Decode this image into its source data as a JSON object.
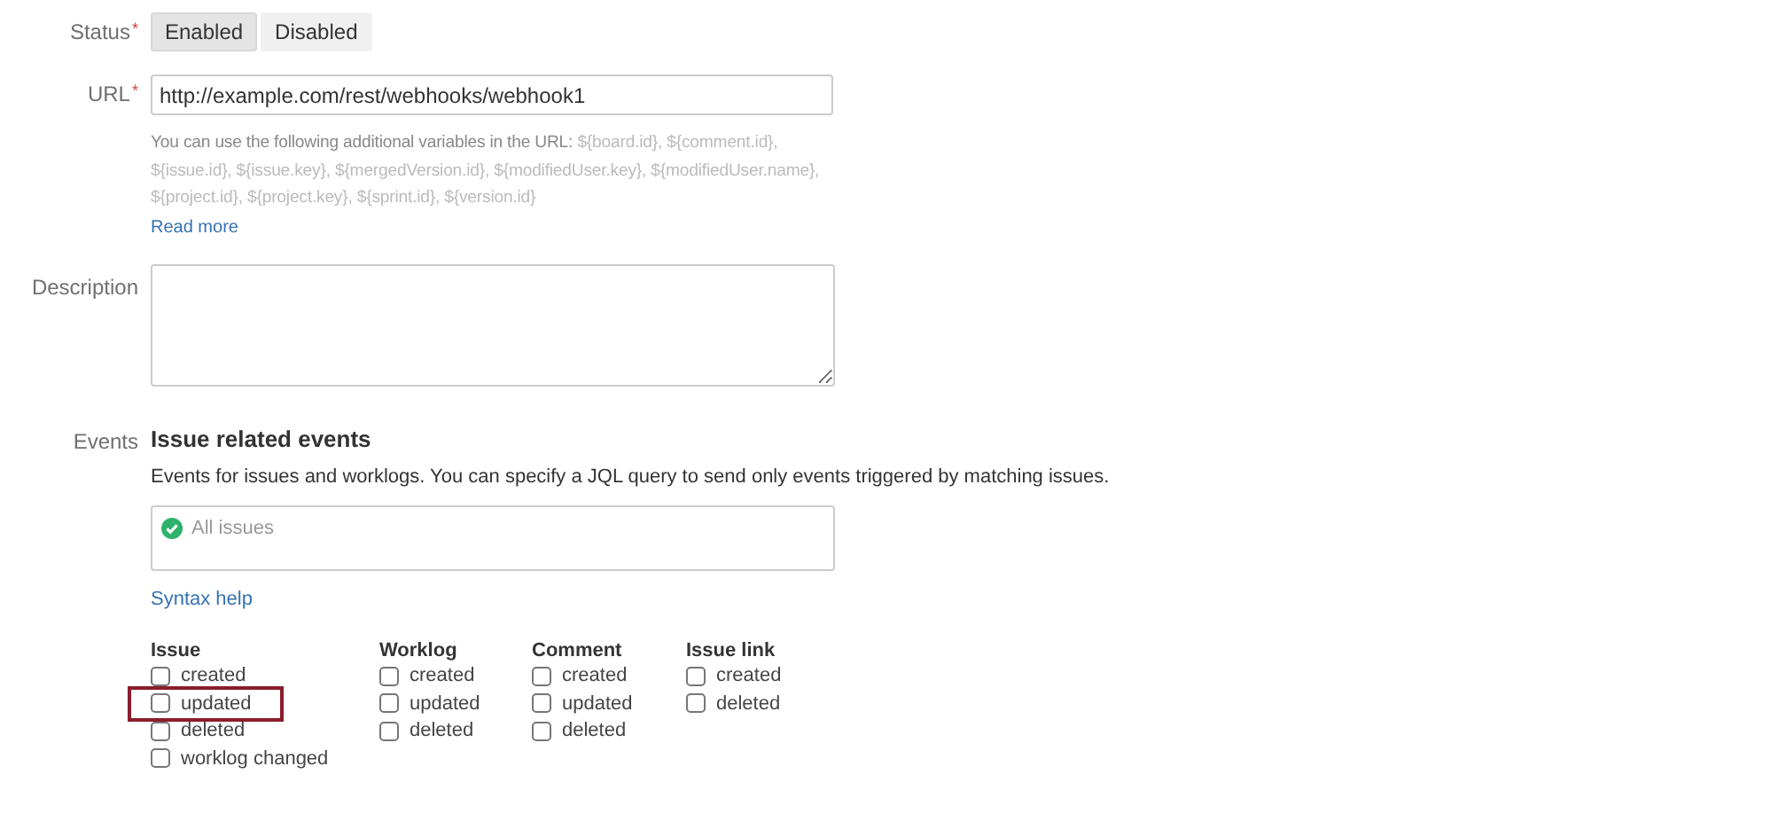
{
  "status": {
    "label": "Status",
    "required_mark": "*",
    "options": [
      {
        "label": "Enabled",
        "selected": true
      },
      {
        "label": "Disabled",
        "selected": false
      }
    ]
  },
  "url": {
    "label": "URL",
    "required_mark": "*",
    "value": "http://example.com/rest/webhooks/webhook1",
    "help": "You can use the following additional variables in the URL: ",
    "variables": "${board.id}, ${comment.id}, ${issue.id}, ${issue.key}, ${mergedVersion.id}, ${modifiedUser.key}, ${modifiedUser.name}, ${project.id}, ${project.key}, ${sprint.id}, ${version.id}",
    "read_more": "Read more"
  },
  "description": {
    "label": "Description"
  },
  "events": {
    "label": "Events",
    "heading": "Issue related events",
    "text": "Events for issues and worklogs. You can specify a JQL query to send only events triggered by matching issues.",
    "jql_placeholder": "All issues",
    "syntax_help": "Syntax help",
    "groups": [
      {
        "title": "Issue",
        "options": [
          {
            "label": "created",
            "checked": false,
            "highlighted": false
          },
          {
            "label": "updated",
            "checked": false,
            "highlighted": true
          },
          {
            "label": "deleted",
            "checked": false,
            "highlighted": false
          },
          {
            "label": "worklog changed",
            "checked": false,
            "highlighted": false
          }
        ]
      },
      {
        "title": "Worklog",
        "options": [
          {
            "label": "created",
            "checked": false,
            "highlighted": false
          },
          {
            "label": "updated",
            "checked": false,
            "highlighted": false
          },
          {
            "label": "deleted",
            "checked": false,
            "highlighted": false
          }
        ]
      },
      {
        "title": "Comment",
        "options": [
          {
            "label": "created",
            "checked": false,
            "highlighted": false
          },
          {
            "label": "updated",
            "checked": false,
            "highlighted": false
          },
          {
            "label": "deleted",
            "checked": false,
            "highlighted": false
          }
        ]
      },
      {
        "title": "Issue link",
        "options": [
          {
            "label": "created",
            "checked": false,
            "highlighted": false
          },
          {
            "label": "deleted",
            "checked": false,
            "highlighted": false
          }
        ]
      }
    ]
  }
}
